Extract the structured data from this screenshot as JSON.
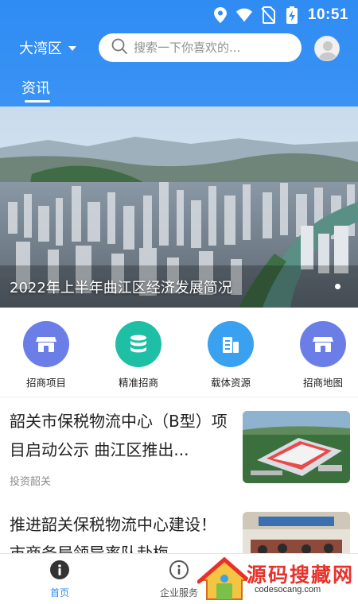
{
  "status_bar": {
    "time": "10:51"
  },
  "header": {
    "region": "大湾区",
    "search_placeholder": "搜索一下你喜欢的...",
    "tab": "资讯"
  },
  "banner": {
    "title": "2022年上半年曲江区经济发展简况"
  },
  "quick_actions": [
    {
      "label": "招商项目",
      "icon": "store-icon",
      "color": "#6b7ee8"
    },
    {
      "label": "精准招商",
      "icon": "database-icon",
      "color": "#1fbfa5"
    },
    {
      "label": "载体资源",
      "icon": "building-icon",
      "color": "#3aa1f0"
    },
    {
      "label": "招商地图",
      "icon": "store-icon",
      "color": "#6b7ee8"
    }
  ],
  "news": [
    {
      "title": "韶关市保税物流中心（B型）项目启动公示 曲江区推出...",
      "source": "投资韶关"
    },
    {
      "title": "推进韶关保税物流中心建设！市商务局领导率队赴梅...",
      "source": ""
    }
  ],
  "bottom_nav": [
    {
      "label": "首页",
      "icon": "info-icon",
      "active": true
    },
    {
      "label": "企业服务",
      "icon": "info-icon",
      "active": false
    }
  ],
  "watermark": {
    "text": "源码搜藏网",
    "url": "codesocang.com"
  },
  "colors": {
    "primary": "#2f8cf3",
    "active_nav": "#2f8cf3"
  }
}
